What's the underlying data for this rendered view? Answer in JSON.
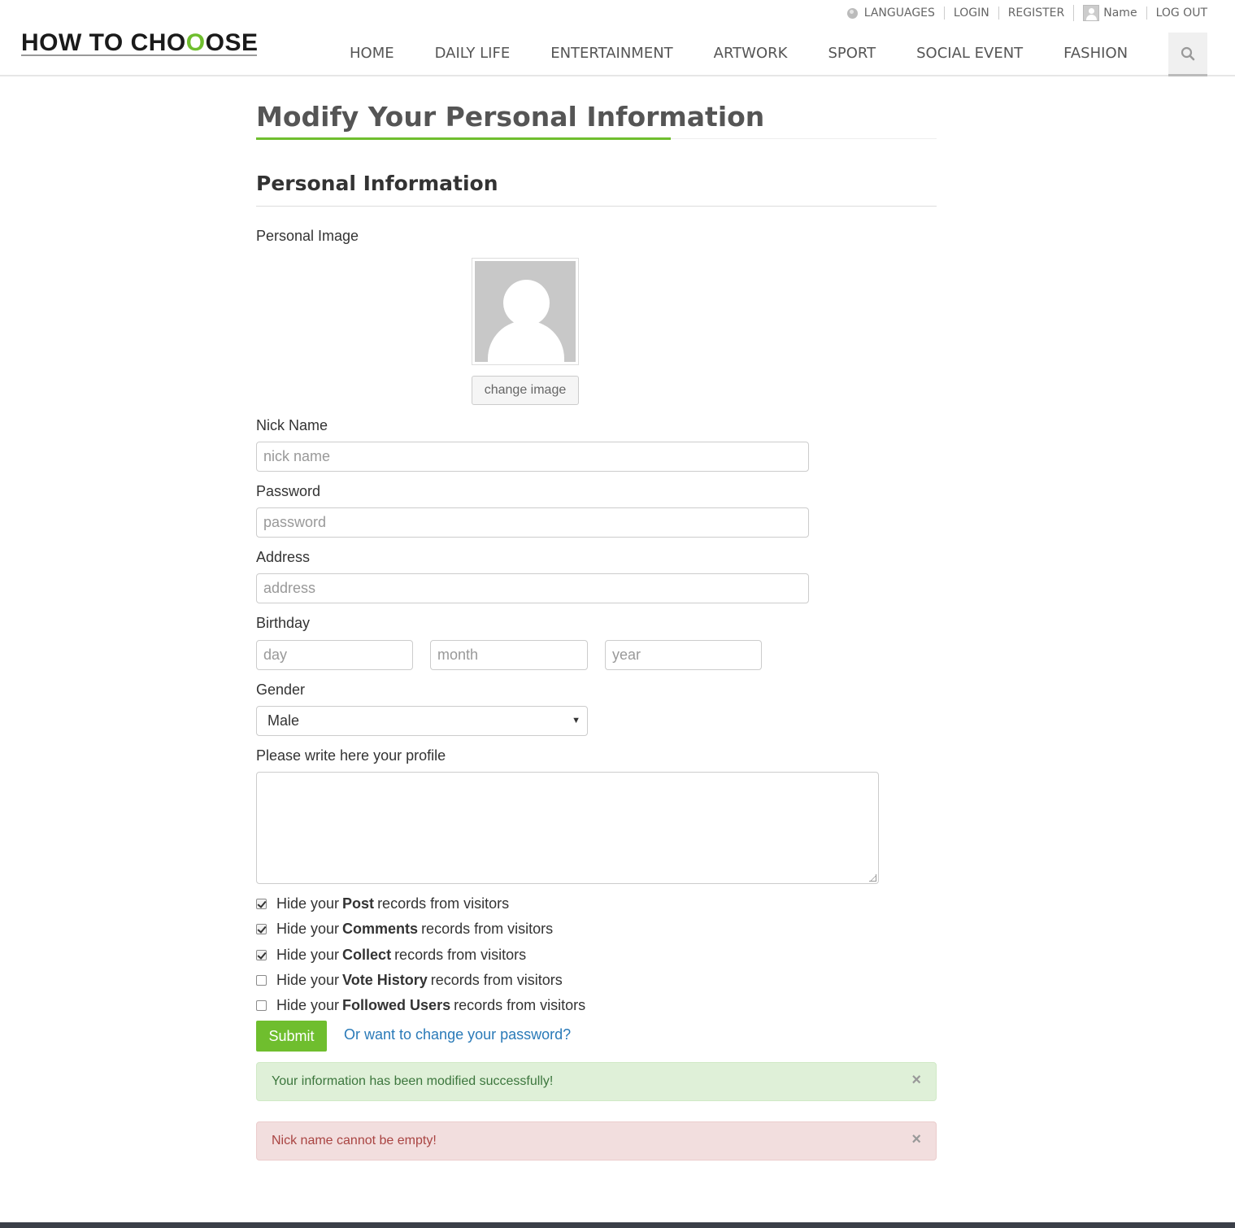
{
  "header": {
    "top_links": {
      "languages": "LANGUAGES",
      "login": "LOGIN",
      "register": "REGISTER",
      "user_name": "Name",
      "logout": "LOG OUT"
    },
    "logo": {
      "part1": "HOW TO CHO",
      "o1": "O",
      "o2": "O",
      "part2": "SE"
    },
    "nav": [
      "HOME",
      "DAILY LIFE",
      "ENTERTAINMENT",
      "ARTWORK",
      "SPORT",
      "SOCIAL EVENT",
      "FASHION"
    ],
    "search_icon": "search-icon"
  },
  "page": {
    "title": "Modify Your Personal Information",
    "section_title": "Personal Information"
  },
  "form": {
    "personal_image_label": "Personal Image",
    "change_image_button": "change image",
    "nick_name_label": "Nick Name",
    "nick_name_placeholder": "nick name",
    "password_label": "Password",
    "password_placeholder": "password",
    "address_label": "Address",
    "address_placeholder": "address",
    "birthday_label": "Birthday",
    "day_placeholder": "day",
    "month_placeholder": "month",
    "year_placeholder": "year",
    "gender_label": "Gender",
    "gender_value": "Male",
    "profile_label": "Please write here your profile",
    "privacy": [
      {
        "pre": "Hide your",
        "bold": "Post",
        "post": "records from visitors",
        "checked": true
      },
      {
        "pre": "Hide your",
        "bold": "Comments",
        "post": "records from visitors",
        "checked": true
      },
      {
        "pre": "Hide your",
        "bold": "Collect",
        "post": "records from visitors",
        "checked": true
      },
      {
        "pre": "Hide your",
        "bold": "Vote History",
        "post": "records from visitors",
        "checked": false
      },
      {
        "pre": "Hide your",
        "bold": "Followed Users",
        "post": "records from visitors",
        "checked": false
      }
    ],
    "submit_button": "Submit",
    "change_password_link": "Or want to change your password?"
  },
  "alerts": {
    "success": "Your information has been modified successfully!",
    "error": "Nick name cannot be empty!",
    "close": "×"
  },
  "colors": {
    "accent": "#6fbe2e",
    "link": "#2a7ab8",
    "success_bg": "#dff0d8",
    "danger_bg": "#f2dede"
  }
}
